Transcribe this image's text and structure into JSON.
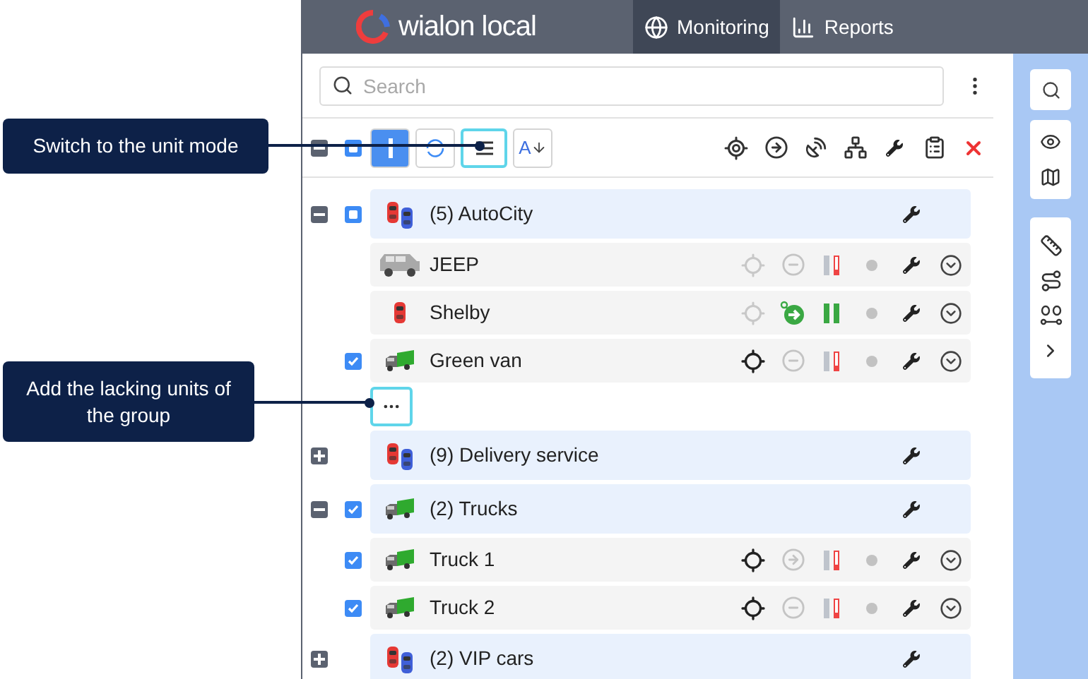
{
  "header": {
    "logo": "wialon local",
    "tabs": [
      {
        "label": "Monitoring",
        "selected": true
      },
      {
        "label": "Reports",
        "selected": false
      }
    ]
  },
  "search": {
    "placeholder": "Search"
  },
  "toolbar": {
    "expanded": true,
    "check": {
      "kind": "partial"
    },
    "sort_label": "A",
    "modes": [
      {
        "kind": "group",
        "selected": true,
        "highlighted": false
      },
      {
        "kind": "cycle",
        "selected": false,
        "highlighted": false
      },
      {
        "kind": "unit",
        "selected": false,
        "highlighted": true
      }
    ]
  },
  "groups": [
    {
      "name": "(5) AutoCity",
      "kind": "cars",
      "expanded": true,
      "check": {
        "kind": "partial"
      },
      "more_button": {
        "highlighted": true
      },
      "units": [
        {
          "name": "JEEP",
          "kind": "jeep",
          "checked": false,
          "located": false,
          "motion": {
            "kind": "stopped"
          },
          "sensor": {
            "kind": "alarm"
          }
        },
        {
          "name": "Shelby",
          "kind": "car",
          "checked": false,
          "located": false,
          "motion": {
            "kind": "moving"
          },
          "sensor": {
            "kind": "ok"
          }
        },
        {
          "name": "Green van",
          "kind": "truck",
          "checked": true,
          "located": true,
          "motion": {
            "kind": "stopped"
          },
          "sensor": {
            "kind": "alarm"
          }
        }
      ]
    },
    {
      "name": "(9) Delivery service",
      "kind": "cars",
      "expanded": false
    },
    {
      "name": "(2) Trucks",
      "kind": "truck",
      "expanded": true,
      "check": {
        "kind": "checked"
      },
      "units": [
        {
          "name": "Truck 1",
          "kind": "truck",
          "checked": true,
          "located": true,
          "motion": {
            "kind": "idle"
          },
          "sensor": {
            "kind": "alarm"
          }
        },
        {
          "name": "Truck 2",
          "kind": "truck",
          "checked": true,
          "located": true,
          "motion": {
            "kind": "stopped"
          },
          "sensor": {
            "kind": "alarm"
          }
        }
      ]
    },
    {
      "name": "(2) VIP cars",
      "kind": "cars",
      "expanded": false
    }
  ],
  "callouts": [
    {
      "text": "Switch to the unit mode"
    },
    {
      "text": "Add the lacking units of the group"
    }
  ]
}
